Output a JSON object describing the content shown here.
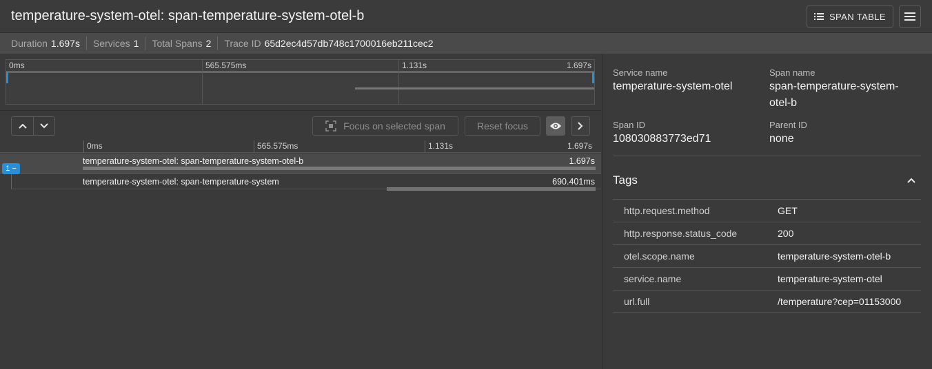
{
  "header": {
    "title": "temperature-system-otel: span-temperature-system-otel-b",
    "span_table_label": "SPAN TABLE"
  },
  "stats": [
    {
      "key": "Duration",
      "value": "1.697s"
    },
    {
      "key": "Services",
      "value": "1"
    },
    {
      "key": "Total Spans",
      "value": "2"
    },
    {
      "key": "Trace ID",
      "value": "65d2ec4d57db748c1700016eb211cec2"
    }
  ],
  "minimap": {
    "ticks": [
      "0ms",
      "565.575ms",
      "1.131s",
      "1.697s"
    ]
  },
  "toolbar": {
    "focus_label": "Focus on selected span",
    "reset_label": "Reset focus"
  },
  "timeline": {
    "ticks": [
      "0ms",
      "565.575ms",
      "1.131s",
      "1.697s"
    ],
    "badge": "1 −",
    "spans": [
      {
        "label": "temperature-system-otel: span-temperature-system-otel-b",
        "duration": "1.697s"
      },
      {
        "label": "temperature-system-otel: span-temperature-system",
        "duration": "690.401ms"
      }
    ]
  },
  "details": {
    "service_name_label": "Service name",
    "service_name": "temperature-system-otel",
    "span_name_label": "Span name",
    "span_name_line1": "span-temperature-system-",
    "span_name_line2": "otel-b",
    "span_id_label": "Span ID",
    "span_id": "108030883773ed71",
    "parent_id_label": "Parent ID",
    "parent_id": "none",
    "tags_title": "Tags",
    "tags": [
      {
        "key": "http.request.method",
        "value": "GET"
      },
      {
        "key": "http.response.status_code",
        "value": "200"
      },
      {
        "key": "otel.scope.name",
        "value": "temperature-system-otel-b"
      },
      {
        "key": "service.name",
        "value": "temperature-system-otel"
      },
      {
        "key": "url.full",
        "value": "/temperature?cep=01153000"
      }
    ]
  },
  "colors": {
    "accent": "#2a8fd4",
    "background": "#3a3a3a"
  }
}
